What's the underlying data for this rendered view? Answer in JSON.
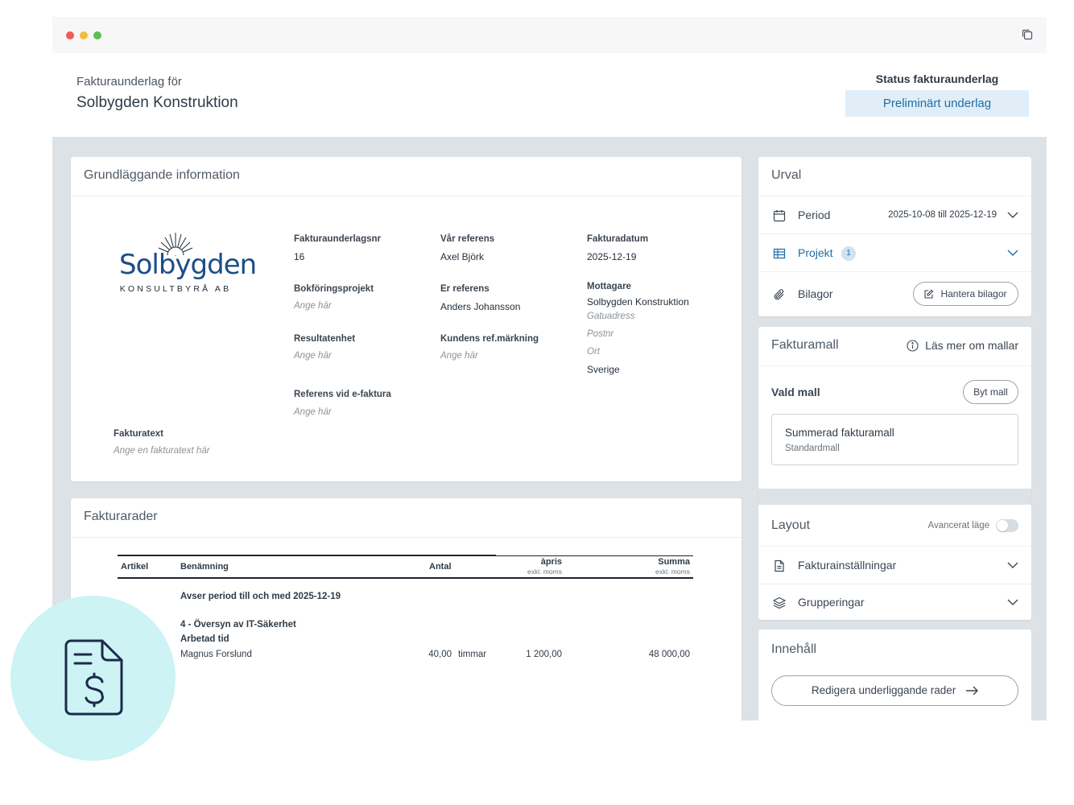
{
  "header": {
    "subtitle": "Fakturaunderlag för",
    "title": "Solbygden Konstruktion",
    "status_label": "Status fakturaunderlag",
    "status_value": "Preliminärt underlag"
  },
  "basic_info": {
    "title": "Grundläggande information",
    "logo": {
      "word": "Solbygden",
      "sub": "KONSULTBYRÅ AB"
    },
    "fields": {
      "invoice_no_label": "Fakturaunderlagsnr",
      "invoice_no": "16",
      "our_ref_label": "Vår referens",
      "our_ref": "Axel Björk",
      "date_label": "Fakturadatum",
      "date": "2025-12-19",
      "project_label": "Bokföringsprojekt",
      "project_ph": "Ange här",
      "your_ref_label": "Er referens",
      "your_ref": "Anders Johansson",
      "recipient_label": "Mottagare",
      "recipient": "Solbygden Konstruktion",
      "street_ph": "Gatuadress",
      "postal_ph": "Postnr",
      "city_ph": "Ort",
      "country": "Sverige",
      "unit_label": "Resultatenhet",
      "unit_ph": "Ange här",
      "cust_ref_label": "Kundens ref.märkning",
      "cust_ref_ph": "Ange här",
      "efaktura_label": "Referens vid e-faktura",
      "efaktura_ph": "Ange här",
      "text_label": "Fakturatext",
      "text_ph": "Ange en fakturatext här"
    }
  },
  "invoice_rows": {
    "title": "Fakturarader",
    "columns": {
      "article": "Artikel",
      "name": "Benämning",
      "qty": "Antal",
      "price": "àpris",
      "price_sub": "exkl. moms",
      "sum": "Summa",
      "sum_sub": "exkl. moms"
    },
    "period_text": "Avser period till och med 2025-12-19",
    "group_title": "4 - Översyn av IT-Säkerhet",
    "sub_title": "Arbetad tid",
    "row": {
      "name": "Magnus Forslund",
      "qty": "40,00",
      "unit": "timmar",
      "price": "1 200,00",
      "sum": "48 000,00"
    }
  },
  "urval": {
    "title": "Urval",
    "period_label": "Period",
    "period_value": "2025-10-08 till 2025-12-19",
    "project_label": "Projekt",
    "project_count": "1",
    "attachments_label": "Bilagor",
    "attachments_button": "Hantera bilagor"
  },
  "template": {
    "title": "Fakturamall",
    "info_link": "Läs mer om mallar",
    "selected_label": "Vald mall",
    "change_button": "Byt mall",
    "template_name": "Summerad fakturamall",
    "template_sub": "Standardmall"
  },
  "layout": {
    "title": "Layout",
    "advanced_label": "Avancerat läge",
    "settings_label": "Fakturainställningar",
    "groups_label": "Grupperingar"
  },
  "content": {
    "title": "Innehåll",
    "edit_button": "Redigera underliggande rader"
  },
  "colors": {
    "accent": "#1e6ea7",
    "badge_bg": "#e1eef7",
    "circle": "#cdf3f4",
    "logo": "#1c4e86"
  }
}
